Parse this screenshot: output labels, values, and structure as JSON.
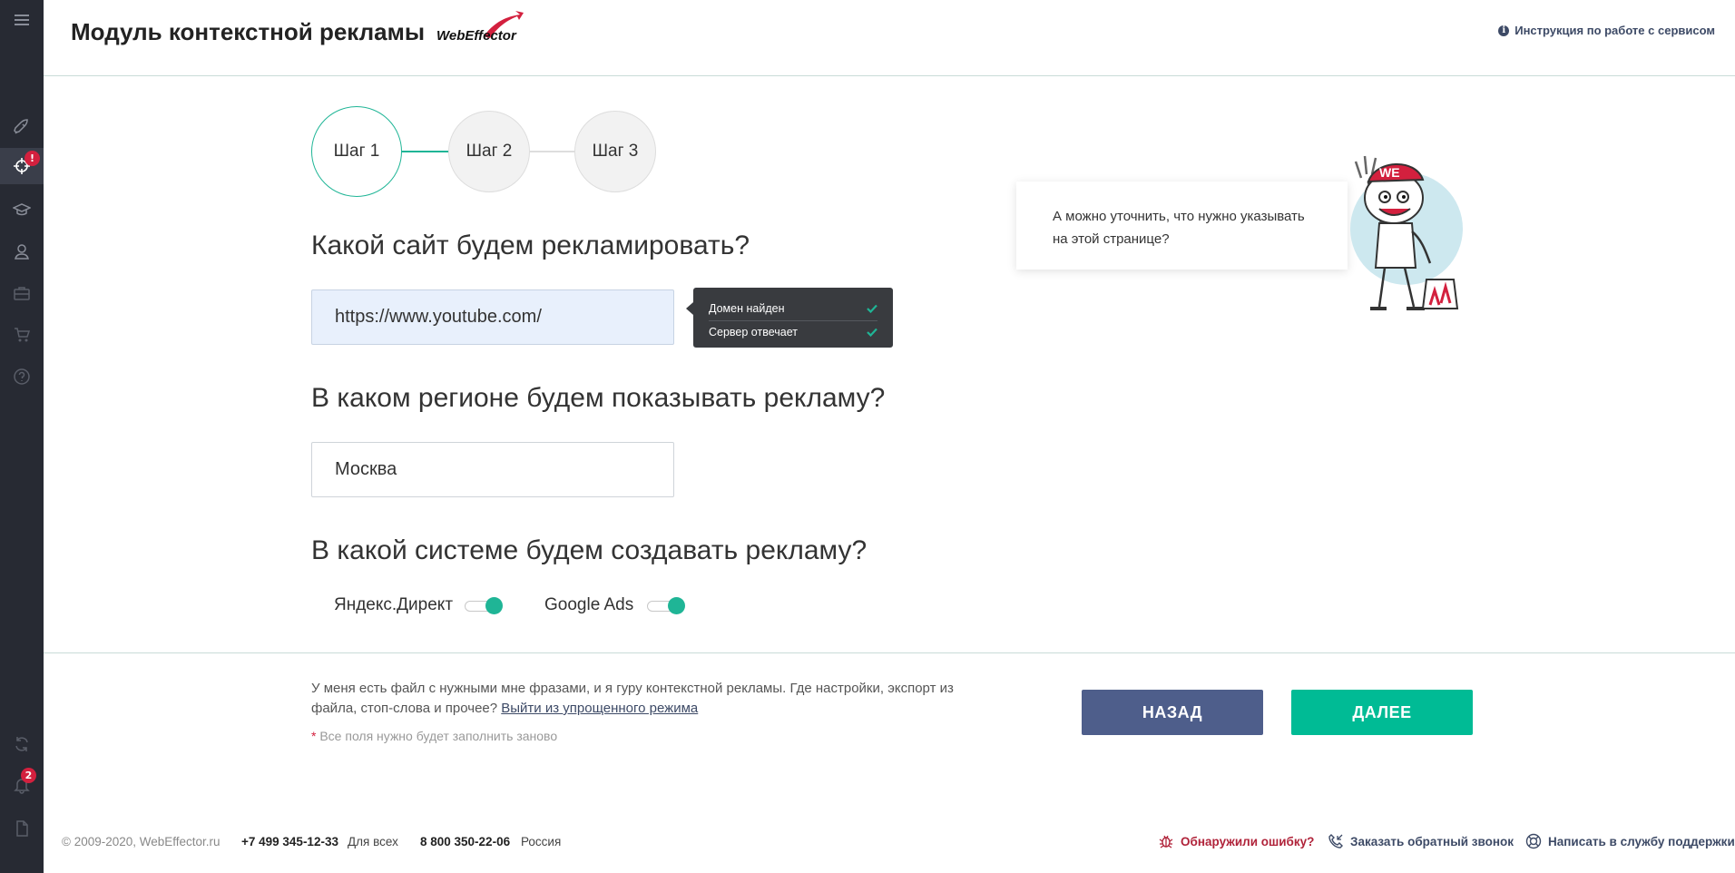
{
  "header": {
    "title": "Модуль контекстной рекламы",
    "logo_text": "WebEffector",
    "help_link": "Инструкция по работе с сервисом"
  },
  "sidebar": {
    "badges": {
      "targeting": "!",
      "notifications": "2"
    }
  },
  "steps": [
    "Шаг 1",
    "Шаг 2",
    "Шаг 3"
  ],
  "questions": {
    "site": "Какой сайт будем рекламировать?",
    "region": "В каком регионе будем показывать рекламу?",
    "system": "В какой системе будем создавать рекламу?"
  },
  "site_input": {
    "value": "https://www.youtube.com/"
  },
  "region_input": {
    "value": "Москва"
  },
  "tooltip": {
    "domain_found": "Домен найден",
    "server_responds": "Сервер отвечает"
  },
  "toggles": [
    {
      "label": "Яндекс.Директ",
      "on": true
    },
    {
      "label": "Google Ads",
      "on": true
    }
  ],
  "assistant": {
    "speech_line1": "А можно уточнить, что нужно указывать",
    "speech_line2": "на этой странице?",
    "cap_text": "WE"
  },
  "bottom": {
    "note": "У меня есть файл с нужными мне фразами, и я гуру контекстной рекламы. Где настройки, экспорт из файла, стоп-слова и прочее?",
    "exit_link": "Выйти из упрощенного режима",
    "required_star": "*",
    "required_note": "Все поля нужно будет заполнить заново",
    "back_button": "НАЗАД",
    "next_button": "ДАЛЕЕ"
  },
  "footer": {
    "copyright": "© 2009-2020, WebEffector.ru",
    "phone1": "+7 499 345-12-33",
    "phone1_label": "Для всех",
    "phone2": "8 800 350-22-06",
    "phone2_label": "Россия",
    "report_bug": "Обнаружили ошибку?",
    "callback": "Заказать обратный звонок",
    "support": "Написать в службу поддержки"
  },
  "colors": {
    "accent": "#00bb95",
    "sidebar_bg": "#272a33",
    "back_button": "#4e5e8b",
    "badge": "#d3203e"
  }
}
